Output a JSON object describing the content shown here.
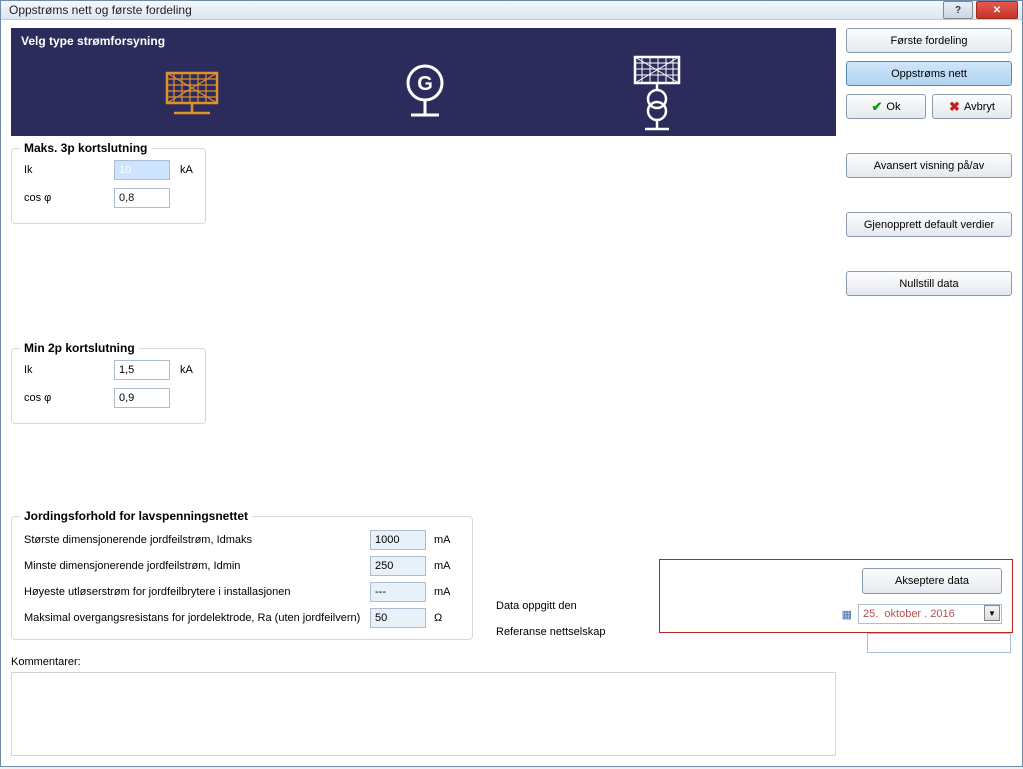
{
  "titlebar": {
    "text": "Oppstrøms nett og første fordeling"
  },
  "type_header": "Velg type strømforsyning",
  "groups": {
    "max3p": {
      "title": "Maks. 3p kortslutning",
      "ik_label": "Ik",
      "ik_value": "10",
      "ik_unit": "kA",
      "cos_label": "cos φ",
      "cos_value": "0,8"
    },
    "min2p": {
      "title": "Min 2p kortslutning",
      "ik_label": "Ik",
      "ik_value": "1,5",
      "ik_unit": "kA",
      "cos_label": "cos φ",
      "cos_value": "0,9"
    },
    "ground": {
      "title": "Jordingsforhold for lavspenningsnettet",
      "row1_label": "Største dimensjonerende jordfeilstrøm, Idmaks",
      "row1_val": "1000",
      "row1_unit": "mA",
      "row2_label": "Minste dimensjonerende jordfeilstrøm, Idmin",
      "row2_val": "250",
      "row2_unit": "mA",
      "row3_label": "Høyeste utløserstrøm for jordfeilbrytere i installasjonen",
      "row3_val": "---",
      "row3_unit": "mA",
      "row4_label": "Maksimal overgangsresistans for jordelektrode, Ra (uten jordfeilvern)",
      "row4_val": "50",
      "row4_unit": "Ω"
    }
  },
  "kommentar_label": "Kommentarer:",
  "right_buttons": {
    "forste": "Første fordeling",
    "oppstroms": "Oppstrøms nett",
    "ok": "Ok",
    "avbryt": "Avbryt",
    "avansert": "Avansert visning på/av",
    "gjenopprett": "Gjenopprett default verdier",
    "nullstill": "Nullstill data"
  },
  "bottom": {
    "aksepter": "Akseptere data",
    "data_oppgitt": "Data oppgitt den",
    "date_value": "25.  oktober . 2016",
    "referanse": "Referanse nettselskap",
    "referanse_value": ""
  }
}
